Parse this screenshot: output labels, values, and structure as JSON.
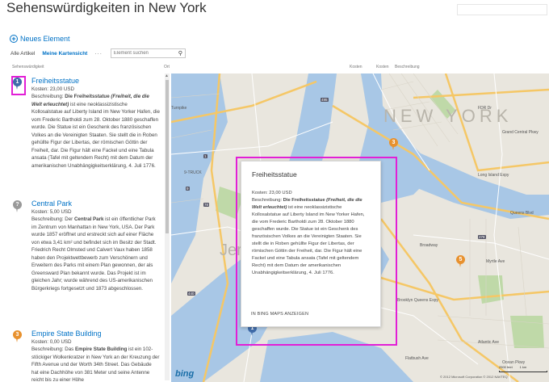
{
  "page_title": "Sehenswürdigkeiten in New York",
  "toolbar": {
    "new_item": "Neues Element",
    "plus": "+",
    "view_all": "Alle Artikel",
    "view_map": "Meine Kartensicht",
    "more": "···",
    "search_placeholder": "Element suchen",
    "search_icon": "magnifier-icon"
  },
  "columns": {
    "attraction": "Sehenswürdigkeit",
    "location": "Ort",
    "cost": "Kosten",
    "cost2": "Kosten",
    "description": "Beschreibung"
  },
  "items": [
    {
      "pin": "1",
      "pin_color": "#3f6ba9",
      "title": "Freiheitsstatue",
      "cost": "Kosten: 23,00 USD",
      "desc_label": "Beschreibung: ",
      "desc_bold": "Die Freiheitsstatue",
      "desc_bold_italic": "(Freiheit, die die Welt erleuchtet)",
      "desc_rest": " ist eine neoklassizistische Kollosalstatue auf Liberty Island im New Yorker Hafen, die vom Frederic Bartholdi zum 28. Oktober 1880 geschaffen wurde. Die Statue ist ein Geschenk des französischen Volkes an die Vereinigten Staaten. Sie stellt die in Roben gehüllte Figur der Libertas, der römischen Göttin der Freiheit, dar. Die Figur hält eine Fackel und eine Tabula ansata (Tafel mit geltendem Recht) mit dem Datum der amerikanischen Unabhängigkeitserklärung, 4. Juli 1776."
    },
    {
      "pin": "?",
      "pin_color": "#999999",
      "title": "Central Park",
      "cost": "Kosten: 5,00 USD",
      "desc_label": "Beschreibung: Der ",
      "desc_bold": "Central Park",
      "desc_rest": " ist ein öffentlicher Park im Zentrum von Manhattan in New York, USA. Der Park wurde 1857 eröffnet und erstreckt sich auf einer Fläche von etwa 3,41 km² und befindet sich im Besitz der Stadt. Friedrich Recht Olmsted und Calvert Vaux haben 1858 haben den Projektwettbewerb zum Verschönern und Erweitern des Parks mit einem Plan gewonnen, der als Greensward Plan bekannt wurde. Das Projekt ist im gleichen Jahr; wurde während des US-amerikanischen Bürgerkriegs fortgesetzt und 1873 abgeschlossen."
    },
    {
      "pin": "3",
      "pin_color": "#e8912e",
      "title": "Empire State Building",
      "cost": "Kosten: 0,00 USD",
      "desc_label": "Beschreibung: Das ",
      "desc_bold": "Empire State Building",
      "desc_rest": " ist ein 102-stöckiger Wolkenkratzer in New York an der Kreuzung der Fifth Avenue und der Worth 34th Street. Das Gebäude hat eine Dachhöhe von 381 Meter und seine Antenne reicht bis zu einer Höhe"
    }
  ],
  "popup": {
    "title": "Freiheitsstatue",
    "cost": "Kosten: 23,00 USD",
    "desc_label": "Beschreibung: ",
    "desc_bold": "Die Freiheitsstatue",
    "desc_bold_italic": "(Freiheit, die die Welt erleuchtet)",
    "desc_rest": " ist eine neoklassizistische Kollosalstatue auf Liberty Island im New Yorker Hafen, die vom Frederic Bartholdi zum 28. Oktober 1880 geschaffen wurde. Die Statue ist ein Geschenk des französischen Volkes an die Vereinigten Staaten. Sie stellt die in Roben gehüllte Figur der Libertas, der römischen Göttin der Freiheit, dar. Die Figur hält eine Fackel und eine Tabula ansata (Tafel mit geltendem Recht) mit dem Datum der amerikanischen Unabhängigkeitserklärung, 4. Juli 1776.",
    "link": "IN BING MAPS ANZEIGEN"
  },
  "map": {
    "labels": {
      "nyc": "NEW YORK",
      "jersey": "Jers",
      "turnpike": "Turnpike",
      "long_island": "Long Island Expy",
      "fdr": "FDR Dr",
      "queens": "Brooklyn Queens Expy",
      "grand": "Grand Central Pkwy",
      "queens_blvd": "Queens Blvd",
      "truck": "9-TRUCK",
      "broadway": "Broadway",
      "atlantic": "Atlantic Ave",
      "myrtle": "Myrtle Ave",
      "flatbush": "Flatbush Ave",
      "ocean": "Ocean Pkwy"
    },
    "shields": [
      "495",
      "1",
      "278",
      "78",
      "9",
      "440"
    ],
    "pin_empire": "3",
    "pin_park": "5",
    "pin_statue": "1",
    "bing_logo": "bing",
    "copyright": "© 2012 Microsoft Corporation  © 2012 NAVTEQ",
    "scale_feet": "2500 feet",
    "scale_km": "1 km"
  }
}
